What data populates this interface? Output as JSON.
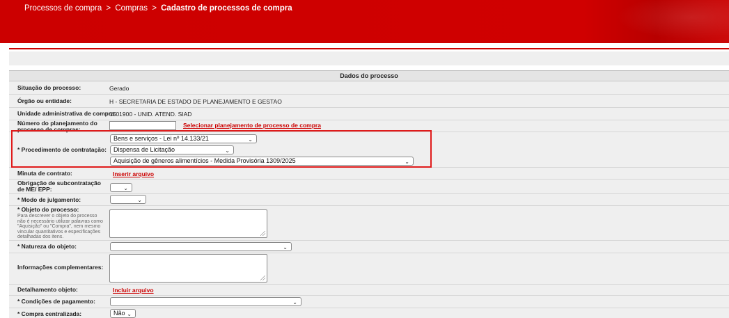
{
  "breadcrumb": {
    "item1": "Processos de compra",
    "sep": ">",
    "item2": "Compras",
    "current": "Cadastro de processos de compra"
  },
  "section": {
    "title": "Dados do processo"
  },
  "fields": {
    "situacao": {
      "label": "Situação do processo:",
      "value": "Gerado"
    },
    "orgao": {
      "label": "Órgão ou entidade:",
      "value": "H - SECRETARIA DE ESTADO DE PLANEJAMENTO E GESTAO"
    },
    "unidade": {
      "label": "Unidade administrativa de compra:",
      "value": "1501900 - UNID. ATEND. SIAD"
    },
    "numero_planejamento": {
      "label": "Número do planejamento do processo de compras:",
      "value": "",
      "link": "Selecionar planejamento de processo de compra"
    },
    "procedimento": {
      "label": "* Procedimento de contratação:",
      "select1": "Bens e serviços - Lei nº 14.133/21",
      "select2": "Dispensa de Licitação",
      "select3": "Aquisição de gêneros alimentícios - Medida Provisória 1309/2025"
    },
    "minuta": {
      "label": "Minuta de contrato:",
      "link": "Inserir arquivo"
    },
    "subcontratacao": {
      "label": "Obrigação de subcontratação de ME/ EPP:",
      "value": ""
    },
    "modo_julgamento": {
      "label": "* Modo de julgamento:",
      "value": ""
    },
    "objeto": {
      "label": "* Objeto do processo:",
      "hint": "Para descrever o objeto do processo não é necessário utilizar palavras como \"Aquisição\" ou \"Compra\", nem mesmo vincular quantitativos e especificações detalhadas dos itens.",
      "value": ""
    },
    "natureza": {
      "label": "* Natureza do objeto:",
      "value": ""
    },
    "informacoes": {
      "label": "Informações complementares:",
      "value": ""
    },
    "detalhamento": {
      "label": "Detalhamento objeto:",
      "link": "Incluir arquivo"
    },
    "condicoes": {
      "label": "* Condições de pagamento:",
      "value": ""
    },
    "centralizada": {
      "label": "* Compra centralizada:",
      "value": "Não"
    }
  },
  "colors": {
    "brand": "#cc0000",
    "highlight": "#e01b1b",
    "panel": "#efefef"
  },
  "icons": {
    "dropdown": "chevron-down-icon",
    "resize": "resize-grip-icon"
  }
}
